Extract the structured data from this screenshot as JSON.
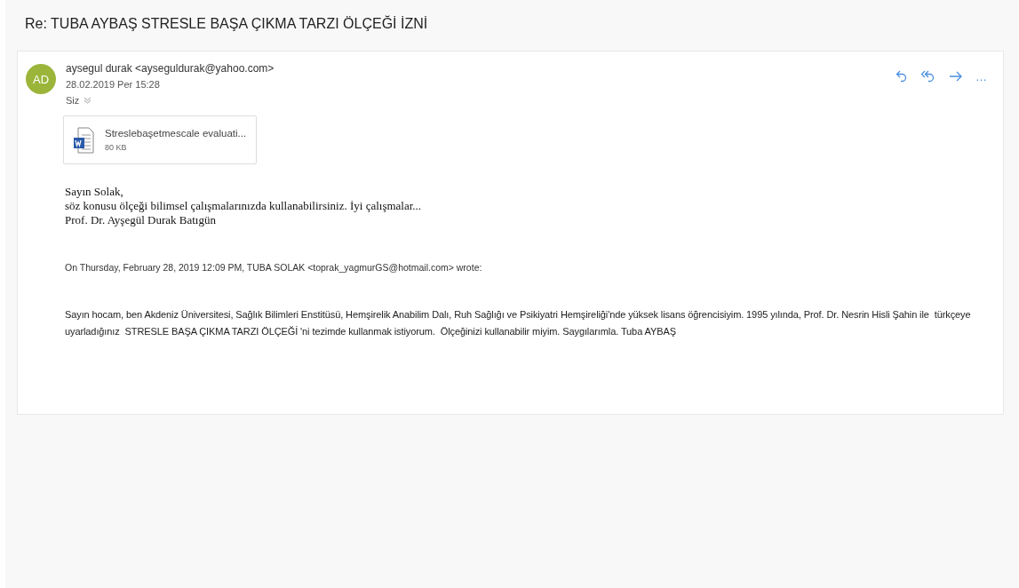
{
  "subject": "Re: TUBA AYBAŞ STRESLE BAŞA ÇIKMA TARZI ÖLÇEĞİ İZNİ",
  "message": {
    "avatar": {
      "initials": "AD",
      "color": "#9bb53a"
    },
    "sender": "aysegul durak <ayseguldurak@yahoo.com>",
    "date": "28.02.2019 Per 15:28",
    "recipients": "Siz",
    "attachment": {
      "name": "Streslebaşetmescale evaluati...",
      "size": "80 KB"
    },
    "body": [
      "Sayın Solak,",
      "söz konusu ölçeği bilimsel çalışmalarınızda kullanabilirsiniz. İyi çalışmalar...",
      "Prof. Dr. Ayşegül Durak Batıgün"
    ],
    "quote_header": "On Thursday, February 28, 2019 12:09 PM, TUBA SOLAK <toprak_yagmurGS@hotmail.com> wrote:",
    "quoted_text": "Sayın hocam, ben Akdeniz Üniversitesi, Sağlık Bilimleri Enstitüsü, Hemşirelik Anabilim Dalı, Ruh Sağlığı ve Psikiyatri Hemşireliği'nde yüksek lisans öğrencisiyim. 1995 yılında, Prof. Dr. Nesrin Hisli Şahin ile  türkçeye uyarladığınız  STRESLE BAŞA ÇIKMA TARZI ÖLÇEĞİ 'ni tezimde kullanmak istiyorum.  Ölçeğinizi kullanabilir miyim. Saygılarımla. Tuba AYBAŞ",
    "actions": [
      "…"
    ]
  }
}
